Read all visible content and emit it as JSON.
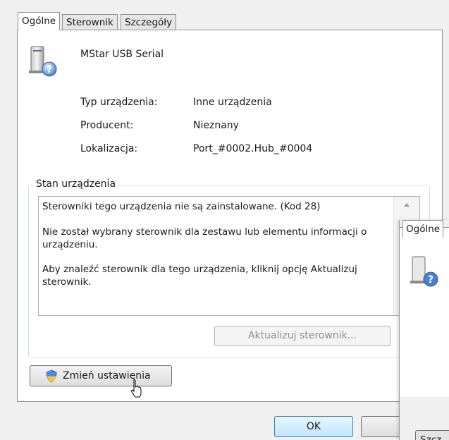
{
  "tabs": [
    {
      "label": "Ogólne",
      "active": true
    },
    {
      "label": "Sterownik",
      "active": false
    },
    {
      "label": "Szczegóły",
      "active": false
    }
  ],
  "device": {
    "name": "MStar USB Serial",
    "icon": "device-unknown-icon",
    "properties": [
      {
        "label": "Typ urządzenia:",
        "value": "Inne urządzenia"
      },
      {
        "label": "Producent:",
        "value": "Nieznany"
      },
      {
        "label": "Lokalizacja:",
        "value": "Port_#0002.Hub_#0004"
      }
    ]
  },
  "status": {
    "title": "Stan urządzenia",
    "lines": [
      "Sterowniki tego urządzenia nie są zainstalowane. (Kod 28)",
      "Nie został wybrany sterownik dla zestawu lub elementu informacji o",
      "urządzeniu.",
      "Aby znaleźć sterownik dla tego urządzenia, kliknij opcję Aktualizuj",
      "sterownik."
    ]
  },
  "buttons": {
    "update_driver": "Aktualizuj sterownik...",
    "change_settings": "Zmień ustawienia",
    "ok": "OK"
  },
  "second_window": {
    "tab": "Ogólne",
    "button_partial": "Szcz"
  },
  "colors": {
    "panel": "#ffffff",
    "dialog": "#f0f0f0",
    "accent": "#3c7fb1"
  }
}
